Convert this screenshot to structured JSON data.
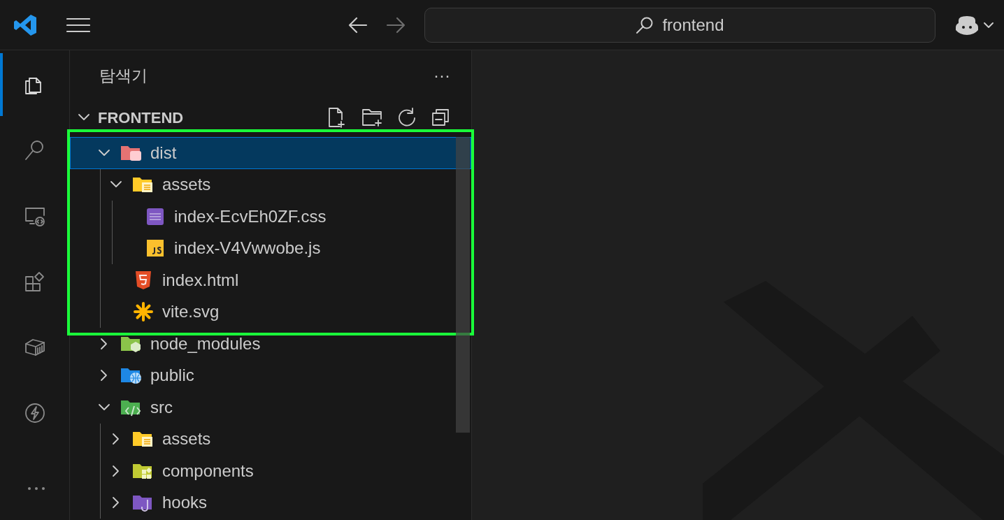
{
  "title_bar": {
    "search": {
      "value": "frontend"
    }
  },
  "activity_bar": [
    {
      "kind": "explorer",
      "selected": true
    },
    {
      "kind": "search",
      "selected": false
    },
    {
      "kind": "remote",
      "selected": false
    },
    {
      "kind": "extensions",
      "selected": false
    },
    {
      "kind": "containers",
      "selected": false
    },
    {
      "kind": "lightning",
      "selected": false
    },
    {
      "kind": "more",
      "selected": false
    }
  ],
  "sidebar": {
    "title": "탐색기",
    "more": "···",
    "section": {
      "title": "FRONTEND",
      "expanded": true
    },
    "tree": [
      {
        "name": "dist",
        "kind": "folder-dist",
        "expanded": true,
        "selected": true,
        "highlighted": true,
        "children": [
          {
            "name": "assets",
            "kind": "folder-assets",
            "expanded": true,
            "selected": false,
            "children": [
              {
                "name": "index-EcvEh0ZF.css",
                "kind": "css",
                "selected": false
              },
              {
                "name": "index-V4Vwwobe.js",
                "kind": "js",
                "selected": false
              }
            ]
          },
          {
            "name": "index.html",
            "kind": "html",
            "selected": false
          },
          {
            "name": "vite.svg",
            "kind": "vite",
            "selected": false
          }
        ]
      },
      {
        "name": "node_modules",
        "kind": "folder-node",
        "expanded": false,
        "selected": false
      },
      {
        "name": "public",
        "kind": "folder-public",
        "expanded": false,
        "selected": false
      },
      {
        "name": "src",
        "kind": "folder-src",
        "expanded": true,
        "selected": false,
        "children": [
          {
            "name": "assets",
            "kind": "folder-assets",
            "expanded": false,
            "selected": false
          },
          {
            "name": "components",
            "kind": "folder-components",
            "expanded": false,
            "selected": false
          },
          {
            "name": "hooks",
            "kind": "folder-hooks",
            "expanded": false,
            "selected": false
          }
        ]
      }
    ]
  }
}
